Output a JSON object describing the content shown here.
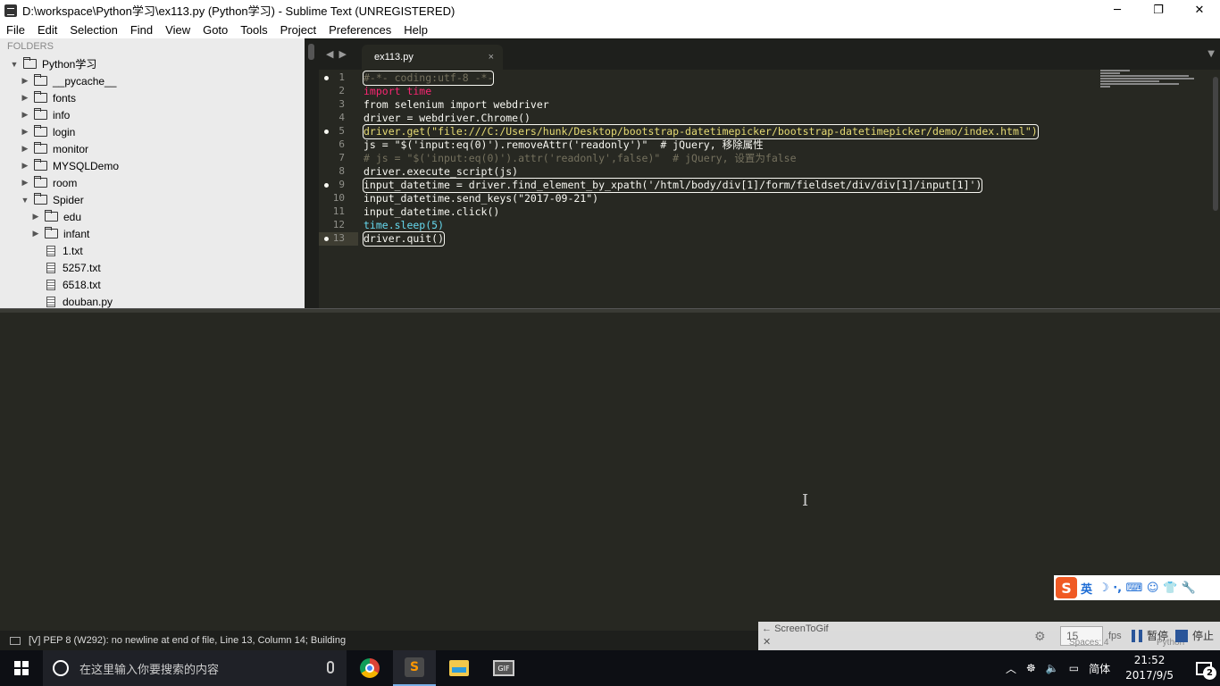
{
  "window": {
    "title": "D:\\workspace\\Python学习\\ex113.py (Python学习) - Sublime Text (UNREGISTERED)",
    "minimize": "─",
    "restore": "❐",
    "close": "✕"
  },
  "menu": [
    "File",
    "Edit",
    "Selection",
    "Find",
    "View",
    "Goto",
    "Tools",
    "Project",
    "Preferences",
    "Help"
  ],
  "sidebar": {
    "header": "FOLDERS",
    "root": "Python学习",
    "items": [
      {
        "label": "__pycache__",
        "type": "folder"
      },
      {
        "label": "fonts",
        "type": "folder"
      },
      {
        "label": "info",
        "type": "folder"
      },
      {
        "label": "login",
        "type": "folder"
      },
      {
        "label": "monitor",
        "type": "folder"
      },
      {
        "label": "MYSQLDemo",
        "type": "folder"
      },
      {
        "label": "room",
        "type": "folder"
      },
      {
        "label": "Spider",
        "type": "folder-open"
      }
    ],
    "spider_children": [
      {
        "label": "edu",
        "type": "folder"
      },
      {
        "label": "infant",
        "type": "folder"
      },
      {
        "label": "1.txt",
        "type": "file"
      },
      {
        "label": "5257.txt",
        "type": "file"
      },
      {
        "label": "6518.txt",
        "type": "file"
      },
      {
        "label": "douban.py",
        "type": "file"
      }
    ]
  },
  "tabs": [
    {
      "label": "ex113.py",
      "close": "×"
    }
  ],
  "editor": {
    "line_numbers": [
      "1",
      "2",
      "3",
      "4",
      "5",
      "6",
      "7",
      "8",
      "9",
      "10",
      "11",
      "12",
      "13"
    ],
    "lines": [
      "#-*- coding:utf-8 -*-",
      "import time",
      "from selenium import webdriver",
      "driver = webdriver.Chrome()",
      "driver.get(\"file:///C:/Users/hunk/Desktop/bootstrap-datetimepicker/bootstrap-datetimepicker/demo/index.html\")",
      "js = \"$('input:eq(0)').removeAttr('readonly')\"  # jQuery, 移除属性",
      "# js = \"$('input:eq(0)').attr('readonly',false)\"  # jQuery, 设置为false",
      "driver.execute_script(js)",
      "input_datetime = driver.find_element_by_xpath('/html/body/div[1]/form/fieldset/div/div[1]/input[1]')",
      "input_datetime.send_keys(\"2017-09-21\")",
      "input_datetime.click()",
      "time.sleep(5)",
      "driver.quit()"
    ]
  },
  "ime": {
    "logo": "S",
    "mode": "英",
    "icons": "☽ ·, ⌨ ☺ 👕 🔧"
  },
  "status": {
    "text": "[V] PEP 8 (W292): no newline at end of file, Line 13, Column 14; Building",
    "spaces": "Spaces: 4",
    "syntax": "Python"
  },
  "screentogif": {
    "title": "ScreenToGif",
    "fps_value": "15",
    "fps_label": "fps",
    "pause": "暂停",
    "stop": "停止"
  },
  "taskbar": {
    "search_placeholder": "在这里输入你要搜索的内容",
    "apps": [
      "chrome-icon",
      "sublime-icon",
      "explorer-icon",
      "screentogif-icon"
    ],
    "tray_lang": "简体",
    "time": "21:52",
    "date": "2017/9/5",
    "notifications": "2"
  },
  "colors": {
    "editor_bg": "#272822",
    "keyword": "#f92672",
    "string": "#e6db74",
    "function": "#66d9ef",
    "comment": "#75715e"
  }
}
